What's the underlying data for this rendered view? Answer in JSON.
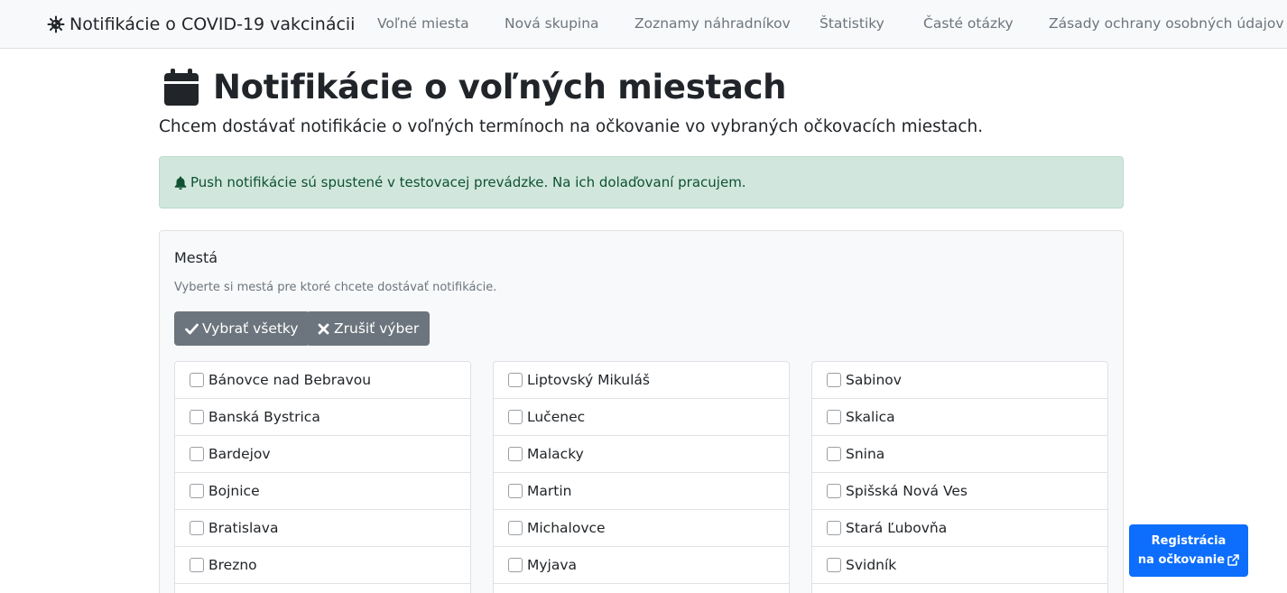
{
  "navbar": {
    "brand": "Notifikácie o COVID-19 vakcinácii",
    "brand_icon": "virus-icon",
    "links": [
      "Voľné miesta",
      "Nová skupina",
      "Zoznamy náhradníkov",
      "Štatistiky",
      "Časté otázky",
      "Zásady ochrany osobných údajov"
    ]
  },
  "header": {
    "icon": "calendar-icon",
    "title": "Notifikácie o voľných miestach",
    "lead": "Chcem dostávať notifikácie o voľných termínoch na očkovanie vo vybraných očkovacích miestach."
  },
  "alert": {
    "icon": "bell-icon",
    "text": "Push notifikácie sú spustené v testovacej prevádzke. Na ich dolaďovaní pracujem."
  },
  "cities": {
    "title": "Mestá",
    "help": "Vyberte si mestá pre ktoré chcete dostávať notifikácie.",
    "select_all": "Vybrať všetky",
    "clear": "Zrušiť výber",
    "columns": [
      [
        "Bánovce nad Bebravou",
        "Banská Bystrica",
        "Bardejov",
        "Bojnice",
        "Bratislava",
        "Brezno"
      ],
      [
        "Liptovský Mikuláš",
        "Lučenec",
        "Malacky",
        "Martin",
        "Michalovce",
        "Myjava"
      ],
      [
        "Sabinov",
        "Skalica",
        "Snina",
        "Spišská Nová Ves",
        "Stará Ľubovňa",
        "Svidník"
      ]
    ]
  },
  "registration": {
    "line1": "Registrácia",
    "line2": "na očkovanie"
  },
  "colors": {
    "primary": "#0d6efd",
    "secondary": "#6c757d",
    "success_bg": "#d1e7dd",
    "success_text": "#0f5132"
  }
}
